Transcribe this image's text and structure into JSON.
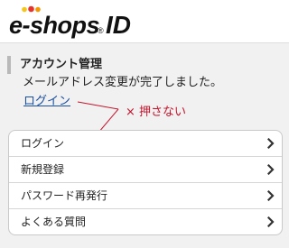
{
  "header": {
    "logo": {
      "text": "e-shops",
      "suffix": "ID",
      "mark": "®",
      "dot_colors": [
        "#f5c518",
        "#e8332b",
        "#f39800"
      ]
    }
  },
  "section": {
    "title": "アカウント管理",
    "message": "メールアドレス変更が完了しました。",
    "login_link": "ログイン"
  },
  "annotation": {
    "text": "× 押さない",
    "color": "#c4142c"
  },
  "menu": {
    "items": [
      {
        "label": "ログイン",
        "icon": "chevron-right-icon"
      },
      {
        "label": "新規登録",
        "icon": "chevron-right-icon"
      },
      {
        "label": "パスワード再発行",
        "icon": "chevron-right-icon"
      },
      {
        "label": "よくある質問",
        "icon": "chevron-right-icon"
      }
    ]
  }
}
